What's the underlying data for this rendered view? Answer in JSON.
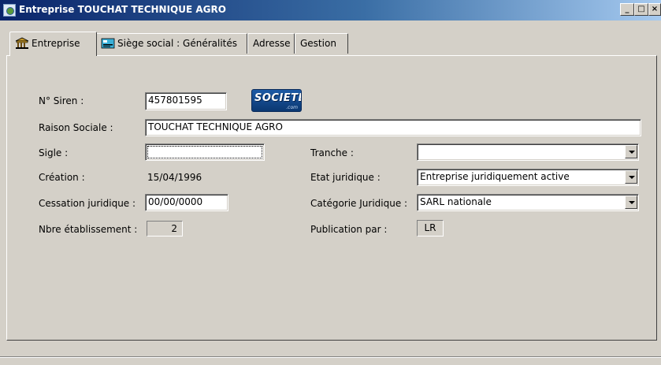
{
  "window": {
    "title": "Entreprise TOUCHAT TECHNIQUE AGRO",
    "minimize_label": "_",
    "restore_label": "□",
    "close_label": "×"
  },
  "tabs": [
    {
      "label": "Entreprise",
      "icon": "building-icon",
      "active": true
    },
    {
      "label": "Siège social : Généralités",
      "icon": "card-icon",
      "active": false
    },
    {
      "label": "Adresse",
      "active": false
    },
    {
      "label": "Gestion",
      "active": false
    }
  ],
  "form": {
    "siren": {
      "label": "N° Siren :",
      "value": "457801595"
    },
    "raison_sociale": {
      "label": "Raison Sociale :",
      "value": "TOUCHAT TECHNIQUE AGRO"
    },
    "sigle": {
      "label": "Sigle :",
      "value": ""
    },
    "creation": {
      "label": "Création :",
      "value": "15/04/1996"
    },
    "cessation": {
      "label": "Cessation juridique :",
      "value": "00/00/0000"
    },
    "nbre_etab": {
      "label": "Nbre établissement :",
      "value": "2"
    },
    "tranche": {
      "label": "Tranche :",
      "value": ""
    },
    "etat_juridique": {
      "label": "Etat juridique :",
      "value": "Entreprise juridiquement active"
    },
    "categorie": {
      "label": "Catégorie Juridique :",
      "value": "SARL nationale"
    },
    "publication": {
      "label": "Publication par :",
      "value": "LR"
    }
  },
  "logo": {
    "main": "SOCIETE",
    "sub": ".com"
  }
}
